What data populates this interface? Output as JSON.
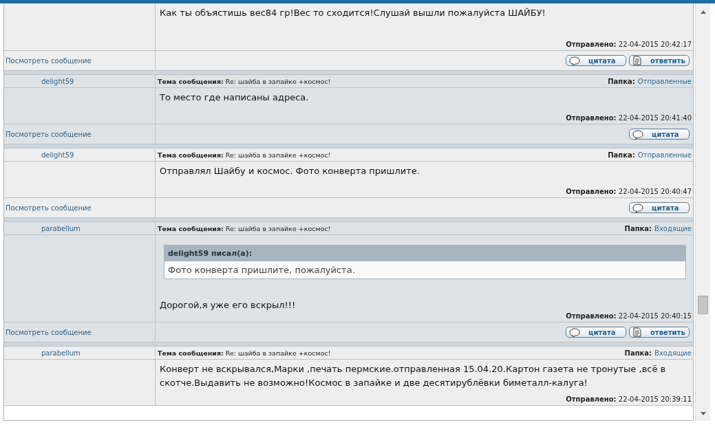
{
  "messages": [
    {
      "body": "Как ты объястишь вес84 гр!Вес то сходится!Слушай вышли пожалуйста ШАЙБУ!",
      "sent": "**Отправлено:** 22-04-2015 20:42:17",
      "view_link": "Посмотреть сообщение",
      "actions": [
        {
          "kind": "quote",
          "label": "цитата"
        },
        {
          "kind": "reply",
          "label": "ответить"
        }
      ]
    },
    {
      "author": "delight59",
      "subject": "**Тема сообщения:** Re: шайба в запайке +космос!",
      "folder_label": "Папка:",
      "folder": "Отправленные",
      "body": "То место где написаны адреса.",
      "sent": "**Отправлено:** 22-04-2015 20:41:40",
      "view_link": "Посмотреть сообщение",
      "actions": [
        {
          "kind": "quote",
          "label": "цитата"
        }
      ]
    },
    {
      "author": "delight59",
      "subject": "**Тема сообщения:** Re: шайба в запайке +космос!",
      "folder_label": "Папка:",
      "folder": "Отправленные",
      "body": "Отправлял Шайбу и космос. Фото конверта пришлите.",
      "sent": "**Отправлено:** 22-04-2015 20:40:47",
      "view_link": "Посмотреть сообщение",
      "actions": [
        {
          "kind": "quote",
          "label": "цитата"
        }
      ]
    },
    {
      "author": "parabellum",
      "subject": "**Тема сообщения:** Re: шайба в запайке +космос!",
      "folder_label": "Папка:",
      "folder": "Входящие",
      "quote": {
        "header": "delight59 писал(а):",
        "text": "Фото конверта пришлите, пожалуйста."
      },
      "body": "Дорогой,я уже его вскрыл!!!",
      "sent": "**Отправлено:** 22-04-2015 20:40:15",
      "view_link": "Посмотреть сообщение",
      "actions": [
        {
          "kind": "quote",
          "label": "цитата"
        },
        {
          "kind": "reply",
          "label": "ответить"
        }
      ]
    },
    {
      "author": "parabellum",
      "subject": "**Тема сообщения:** Re: шайба в запайке +космос!",
      "folder_label": "Папка:",
      "folder": "Входящие",
      "body": "Конверт не вскрывался,Марки ,печать пермские.отправленная 15.04.20.Картон газета не тронутые ,всё в скотче.Выдавить не возможно!Космос в запайке и две десятирублёвки биметалл-калуга!",
      "sent": "**Отправлено:** 22-04-2015 20:39:11"
    }
  ]
}
